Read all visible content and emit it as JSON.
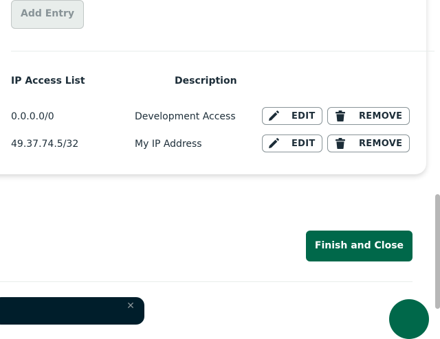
{
  "add_entry_label": "Add Entry",
  "table": {
    "headers": {
      "ip": "IP Access List",
      "description": "Description"
    },
    "rows": [
      {
        "ip": "0.0.0.0/0",
        "description": "Development Access",
        "edit_label": "EDIT",
        "remove_label": "REMOVE"
      },
      {
        "ip": "49.37.74.5/32",
        "description": "My IP Address",
        "edit_label": "EDIT",
        "remove_label": "REMOVE"
      }
    ]
  },
  "finish_label": "Finish and Close",
  "icons": {
    "edit": "pencil-icon",
    "remove": "trash-icon",
    "toast_close": "close-icon"
  },
  "colors": {
    "primary": "#00684a",
    "text": "#1c2d38",
    "disabled_bg": "#e8edeb",
    "disabled_text": "#889397",
    "toast_bg": "#001e2b"
  }
}
